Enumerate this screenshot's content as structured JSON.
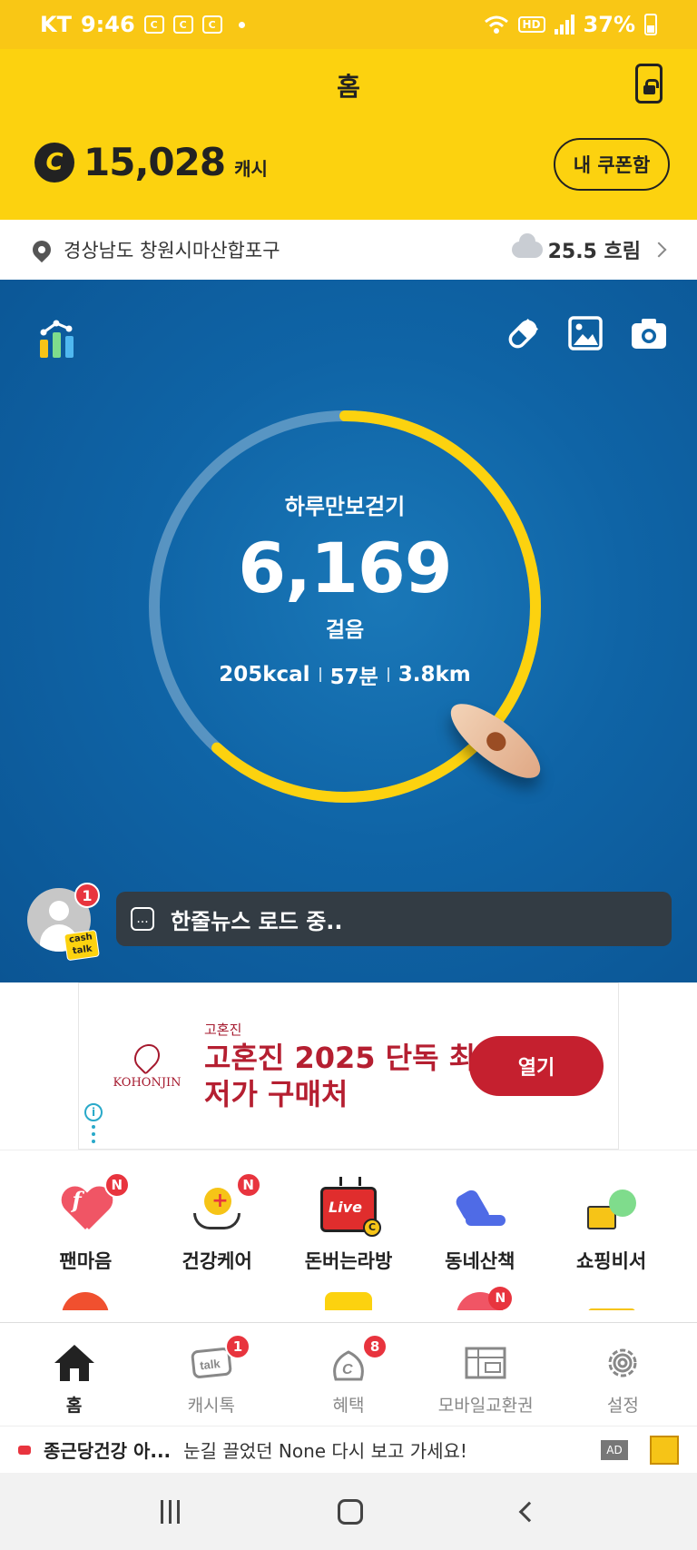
{
  "status_bar": {
    "carrier": "KT",
    "time": "9:46",
    "battery": "37%",
    "network_badge": "HD"
  },
  "header": {
    "title": "홈",
    "cash_amount": "15,028",
    "cash_unit": "캐시",
    "coin_symbol": "C",
    "coupon_button": "내 쿠폰함"
  },
  "location": {
    "address": "경상남도 창원시마산합포구",
    "weather": "25.5 흐림"
  },
  "steps": {
    "title": "하루만보걷기",
    "count": "6,169",
    "unit": "걸음",
    "kcal": "205kcal",
    "minutes": "57분",
    "distance": "3.8km",
    "progress": 0.617,
    "ring_color": "#fcd20f",
    "ring_track_color": "rgba(255,255,255,0.3)"
  },
  "news": {
    "badge": "1",
    "cashtalk_line1": "cash",
    "cashtalk_line2": "talk",
    "bubble_icon": "...",
    "text": "한줄뉴스 로드 중.."
  },
  "ad": {
    "brand": "KOHONJIN",
    "sponsor": "고혼진",
    "headline": "고혼진 2025 단독 최저가 구매처",
    "button": "열기",
    "info": "i"
  },
  "menu": {
    "items": [
      {
        "label": "팬마음",
        "badge": "N",
        "icon": "heart-f-icon",
        "glyph": "f"
      },
      {
        "label": "건강케어",
        "badge": "N",
        "icon": "health-care-icon",
        "glyph": "+"
      },
      {
        "label": "돈버는라방",
        "badge": "",
        "icon": "live-tv-icon",
        "glyph": "Live"
      },
      {
        "label": "동네산책",
        "badge": "",
        "icon": "sneaker-icon"
      },
      {
        "label": "쇼핑비서",
        "badge": "",
        "icon": "shopping-cart-icon"
      }
    ],
    "row2_badge": "N"
  },
  "bottom_nav": [
    {
      "label": "홈",
      "icon": "home-icon",
      "badge": "",
      "active": true
    },
    {
      "label": "캐시톡",
      "icon": "talk-icon",
      "badge": "1",
      "active": false
    },
    {
      "label": "혜택",
      "icon": "benefit-icon",
      "badge": "8",
      "active": false
    },
    {
      "label": "모바일교환권",
      "icon": "gift-card-icon",
      "badge": "",
      "active": false
    },
    {
      "label": "설정",
      "icon": "settings-icon",
      "badge": "",
      "active": false
    }
  ],
  "ad_strip": {
    "brand": "종근당건강 아...",
    "text": "눈길 끌었던 None 다시 보고 가세요!",
    "badge": "AD"
  },
  "colors": {
    "brand_yellow": "#fcd20f",
    "badge_red": "#e8343e",
    "ad_red": "#c5202f",
    "hero_blue": "#0f64a6"
  }
}
